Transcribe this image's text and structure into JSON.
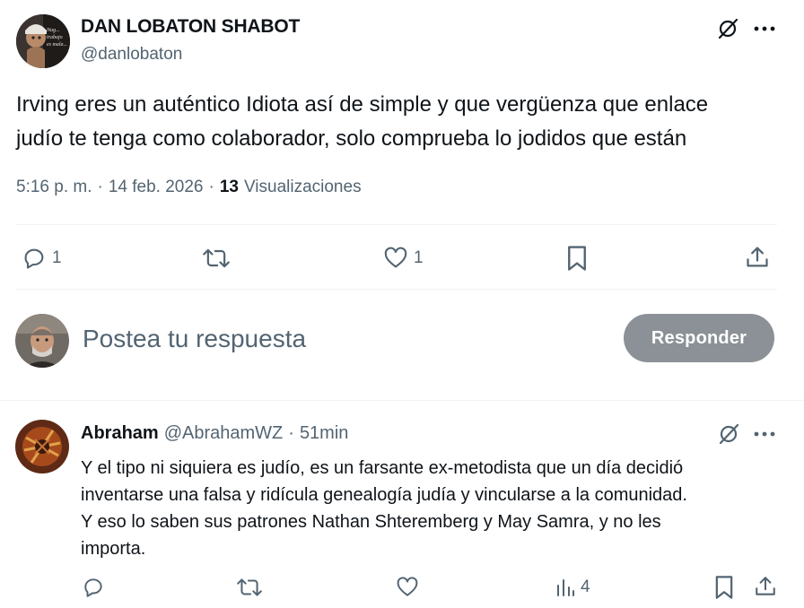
{
  "tweet": {
    "author_name": "DAN LOBATON SHABOT",
    "author_handle": "@danlobaton",
    "text_line1": "Irving eres un auténtico Idiota así de simple y que vergüenza que enlace",
    "text_line2": "judío te tenga como colaborador, solo comprueba lo jodidos que están",
    "time": "5:16 p. m.",
    "sep": "·",
    "date": "14 feb. 2026",
    "views_count": "13",
    "views_label": "Visualizaciones",
    "replies": "1",
    "likes": "1",
    "avatar_text": "Nag... trabajo es mala..."
  },
  "composer": {
    "placeholder": "Postea tu respuesta",
    "reply_button": "Responder"
  },
  "reply": {
    "author_name": "Abraham",
    "author_handle": "@AbrahamWZ",
    "sep": "·",
    "time": "51min",
    "lines": [
      "Y el tipo ni siquiera es judío, es un farsante ex-metodista que un día decidió",
      "inventarse una falsa y ridícula genealogía judía y vincularse a la comunidad.",
      "Y eso lo saben sus patrones Nathan Shteremberg y May Samra, y no les",
      "importa."
    ],
    "views": "4"
  },
  "icons": {
    "grok": "grok-icon",
    "more": "more-icon",
    "reply": "reply-icon",
    "retweet": "retweet-icon",
    "like": "like-icon",
    "bookmark": "bookmark-icon",
    "share": "share-icon",
    "views": "views-icon"
  },
  "colors": {
    "muted": "#536471",
    "divider": "#eff3f4",
    "button_disabled": "#8b9196"
  }
}
